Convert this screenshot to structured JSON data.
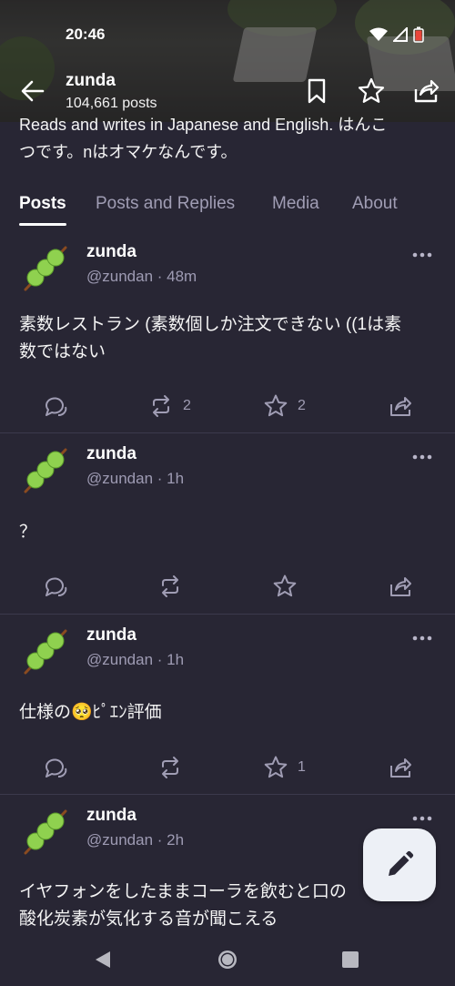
{
  "status_bar": {
    "time": "20:46"
  },
  "header": {
    "title": "zunda",
    "subtitle": "104,661 posts"
  },
  "bio": {
    "line1": "Reads and writes in Japanese and English. はんこ",
    "line2": "つです。nはオマケなんです。"
  },
  "tabs": [
    {
      "label": "Posts"
    },
    {
      "label": "Posts and Replies"
    },
    {
      "label": "Media"
    },
    {
      "label": "About"
    }
  ],
  "posts": [
    {
      "name": "zunda",
      "meta": "@zundan · 48m",
      "text_line1": "素数レストラン (素数個しか注文できない ((1は素",
      "text_line2": "数ではない",
      "reblogs": "2",
      "favourites": "2"
    },
    {
      "name": "zunda",
      "meta": "@zundan · 1h",
      "text_line1": "？",
      "reblogs": "",
      "favourites": ""
    },
    {
      "name": "zunda",
      "meta": "@zundan · 1h",
      "text_line1": "仕様の🥺ﾋﾟｴﾝ評価",
      "reblogs": "",
      "favourites": "1"
    },
    {
      "name": "zunda",
      "meta": "@zundan · 2h",
      "text_line1": "イヤフォンをしたままコーラを飲むと口の",
      "text_line2": "酸化炭素が気化する音が聞こえる"
    }
  ],
  "colors": {
    "background": "#282634",
    "muted_text": "#a09db4",
    "divider": "#3c3a4c",
    "fab_background": "#edf0f6"
  },
  "icons": {
    "back": "arrow-left-icon",
    "bookmark": "bookmark-icon",
    "star": "star-icon",
    "share": "share-icon",
    "reply": "reply-icon",
    "reblog": "reblog-icon",
    "more": "more-horizontal-icon",
    "compose": "pencil-icon"
  }
}
